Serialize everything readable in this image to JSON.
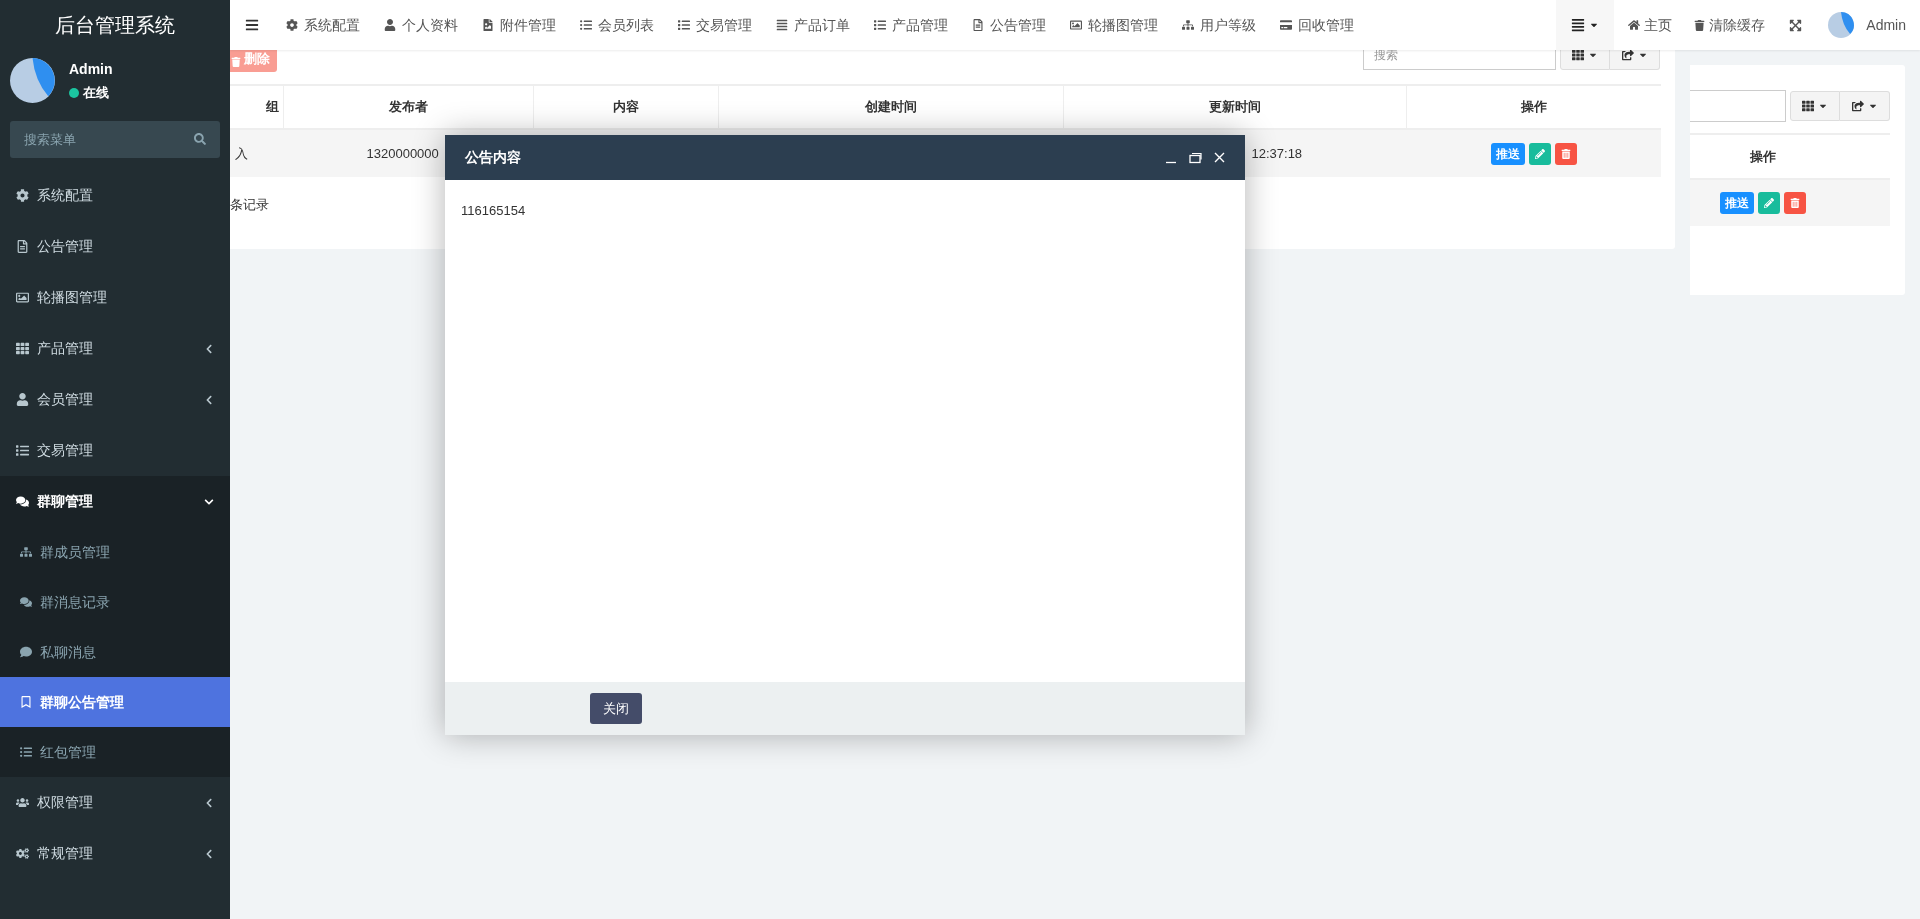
{
  "sidebar": {
    "title": "后台管理系统",
    "user": {
      "name": "Admin",
      "status": "在线"
    },
    "search": {
      "placeholder": "搜索菜单"
    },
    "items": [
      {
        "label": "系统配置",
        "kind": "link",
        "selected": false
      },
      {
        "label": "公告管理",
        "kind": "link",
        "selected": false
      },
      {
        "label": "轮播图管理",
        "kind": "link",
        "selected": false
      },
      {
        "label": "产品管理",
        "kind": "group",
        "expanded": false,
        "selected": false
      },
      {
        "label": "会员管理",
        "kind": "group",
        "expanded": false,
        "selected": false
      },
      {
        "label": "交易管理",
        "kind": "link",
        "selected": false
      },
      {
        "label": "群聊管理",
        "kind": "group",
        "expanded": true,
        "selected": false,
        "children": [
          {
            "label": "群成员管理",
            "selected": false
          },
          {
            "label": "群消息记录",
            "selected": false
          },
          {
            "label": "私聊消息",
            "selected": false
          },
          {
            "label": "群聊公告管理",
            "selected": true
          },
          {
            "label": "红包管理",
            "selected": false
          }
        ]
      },
      {
        "label": "权限管理",
        "kind": "group",
        "expanded": false,
        "selected": false
      },
      {
        "label": "常规管理",
        "kind": "group",
        "expanded": false,
        "selected": false
      }
    ]
  },
  "topbar": {
    "nav": [
      "系统配置",
      "个人资料",
      "附件管理",
      "会员列表",
      "交易管理",
      "产品订单",
      "产品管理",
      "公告管理",
      "轮播图管理",
      "用户等级",
      "回收管理"
    ],
    "home": "主页",
    "clear_cache": "清除缓存",
    "user": "Admin"
  },
  "main_panel": {
    "delete_button": "删除",
    "search": {
      "placeholder": "搜索"
    },
    "table": {
      "columns": [
        "组",
        "发布者",
        "内容",
        "创建时间",
        "更新时间",
        "操作"
      ],
      "rows": [
        {
          "column_1": "入",
          "publisher": "1320000000",
          "updated": "12:37:18",
          "push": "推送"
        }
      ]
    },
    "footer": "条记录"
  },
  "side_panel": {
    "table": {
      "columns": [
        "操作"
      ],
      "rows": [
        {
          "push": "推送"
        }
      ]
    }
  },
  "dialog": {
    "title": "公告内容",
    "body": "116165154",
    "close_button": "关闭"
  }
}
